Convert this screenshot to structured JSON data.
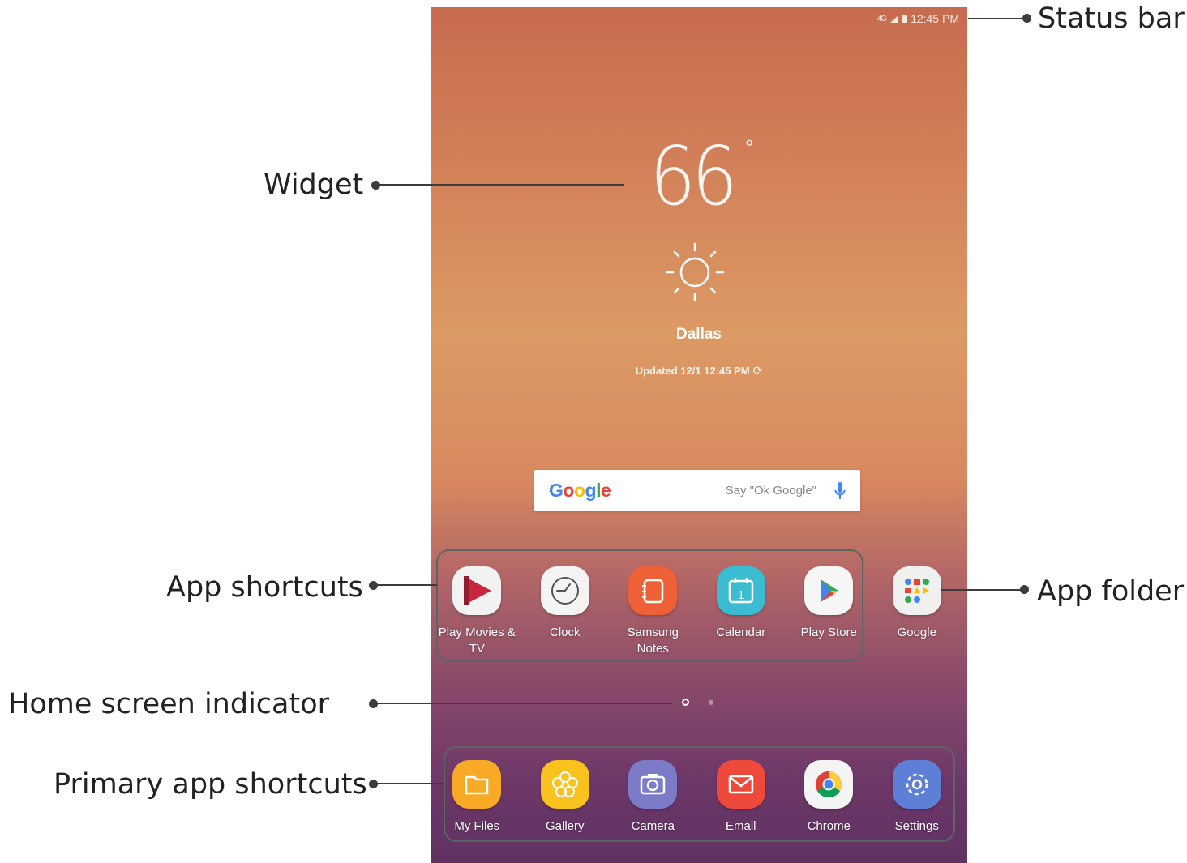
{
  "status_bar": {
    "signal": "4G",
    "time": "12:45 PM"
  },
  "weather": {
    "temperature": "66",
    "unit": "°",
    "condition_icon": "sun-icon",
    "city": "Dallas",
    "updated": "Updated 12/1 12:45 PM"
  },
  "search": {
    "logo": "Google",
    "hint": "Say \"Ok Google\""
  },
  "app_shortcuts": [
    {
      "label": "Play Movies & TV",
      "icon": "play-movies-icon",
      "color": "#c8263c"
    },
    {
      "label": "Clock",
      "icon": "clock-icon",
      "color": "#f4f4f4"
    },
    {
      "label": "Samsung Notes",
      "icon": "samsung-notes-icon",
      "color": "#ee6136"
    },
    {
      "label": "Calendar",
      "icon": "calendar-icon",
      "color": "#3bbcd0"
    },
    {
      "label": "Play Store",
      "icon": "play-store-icon",
      "color": "#f6f6f6"
    },
    {
      "label": "Google",
      "icon": "google-folder-icon",
      "color": "#f0f0f0"
    }
  ],
  "primary_apps": [
    {
      "label": "My Files",
      "icon": "folder-icon",
      "color": "#f8a925"
    },
    {
      "label": "Gallery",
      "icon": "gallery-icon",
      "color": "#f9c21c"
    },
    {
      "label": "Camera",
      "icon": "camera-icon",
      "color": "#7b7bc8"
    },
    {
      "label": "Email",
      "icon": "email-icon",
      "color": "#ee4a3c"
    },
    {
      "label": "Chrome",
      "icon": "chrome-icon",
      "color": "#f4f4f4"
    },
    {
      "label": "Settings",
      "icon": "settings-icon",
      "color": "#5e7fd6"
    }
  ],
  "callouts": {
    "status_bar": "Status bar",
    "widget": "Widget",
    "app_shortcuts": "App shortcuts",
    "app_folder": "App folder",
    "home_indicator": "Home screen indicator",
    "primary_shortcuts": "Primary app shortcuts"
  }
}
